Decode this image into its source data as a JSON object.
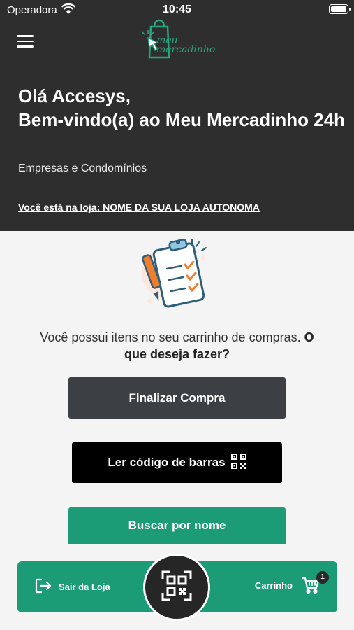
{
  "status_bar": {
    "carrier": "Operadora",
    "time": "10:45"
  },
  "header": {
    "logo_text_line1": "meu",
    "logo_text_line2": "mercadinho",
    "greeting_line1": "Olá Accesys,",
    "greeting_line2": "Bem-vindo(a) ao Meu Mercadinho 24h",
    "subtitle": "Empresas e Condomínios",
    "store_notice": "Você está na loja: NOME DA SUA LOJA AUTONOMA"
  },
  "main": {
    "message_part1": "Você possui itens no seu carrinho de compras. ",
    "message_bold": "O que deseja fazer?",
    "finalize_label": "Finalizar Compra",
    "scan_label": "Ler código de barras",
    "search_label": "Buscar por nome"
  },
  "bottom_bar": {
    "exit_label": "Sair da Loja",
    "cart_label": "Carrinho",
    "cart_count": "1"
  },
  "colors": {
    "header_bg": "#2e2e2e",
    "accent_green": "#1c9b77",
    "finalize_bg": "#3c3f43",
    "scan_bg": "#000000"
  },
  "icons": [
    "wifi-icon",
    "battery-icon",
    "menu-icon",
    "shopping-bag-logo",
    "clipboard-checklist-illustration",
    "qr-code-icon",
    "exit-icon",
    "cart-icon"
  ]
}
